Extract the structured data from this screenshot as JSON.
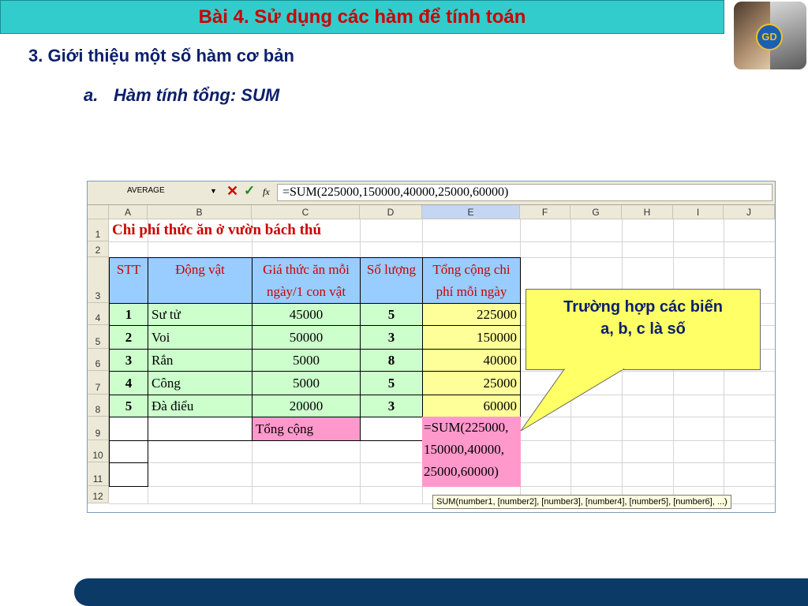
{
  "title": "Bài 4. Sử dụng các hàm để tính toán",
  "logo": {
    "emblem_text": "GD"
  },
  "section_heading": "3. Giới thiệu một số hàm cơ bản",
  "sub_marker": "a.",
  "sub_heading": "Hàm tính tổng: SUM",
  "spreadsheet": {
    "name_box": "AVERAGE",
    "cancel_symbol": "✕",
    "enter_symbol": "✓",
    "fx_label": "fx",
    "formula": "=SUM(225000,150000,40000,25000,60000)",
    "columns": [
      "A",
      "B",
      "C",
      "D",
      "E",
      "F",
      "G",
      "H",
      "I",
      "J"
    ],
    "rows": [
      "1",
      "2",
      "3",
      "4",
      "5",
      "6",
      "7",
      "8",
      "9",
      "10",
      "11",
      "12"
    ],
    "sheet_title": "Chi phí thức ăn ở vườn bách thú",
    "headers": [
      "STT",
      "Động vật",
      "Giá thức ăn mỗi ngày/1 con vật",
      "Số lượng",
      "Tổng cộng chi phí mỗi ngày"
    ],
    "data_rows": [
      {
        "stt": "1",
        "animal": "Sư  tử",
        "price": "45000",
        "qty": "5",
        "total": "225000"
      },
      {
        "stt": "2",
        "animal": "Voi",
        "price": "50000",
        "qty": "3",
        "total": "150000"
      },
      {
        "stt": "3",
        "animal": "Rắn",
        "price": "5000",
        "qty": "8",
        "total": "40000"
      },
      {
        "stt": "4",
        "animal": "Công",
        "price": "5000",
        "qty": "5",
        "total": "25000"
      },
      {
        "stt": "5",
        "animal": "Đà điểu",
        "price": "20000",
        "qty": "3",
        "total": "60000"
      }
    ],
    "total_label": "Tổng cộng",
    "editing_cell_lines": [
      "=SUM(225000,",
      "150000,40000,",
      "25000,60000)"
    ],
    "tooltip_hint": "SUM(number1, [number2], [number3], [number4], [number5], [number6], ...)"
  },
  "callout": {
    "line1": "Trường hợp các biến",
    "line2": "a, b, c là số"
  },
  "colors": {
    "title_bg": "#33cccc",
    "title_text": "#cc0000",
    "heading": "#0b1f6b",
    "header_fill": "#99ccff",
    "data_fill": "#ccffcc",
    "total_fill": "#ffff99",
    "sum_fill": "#ff99cc",
    "callout_fill": "#ffff66",
    "footer": "#0b3a66"
  }
}
